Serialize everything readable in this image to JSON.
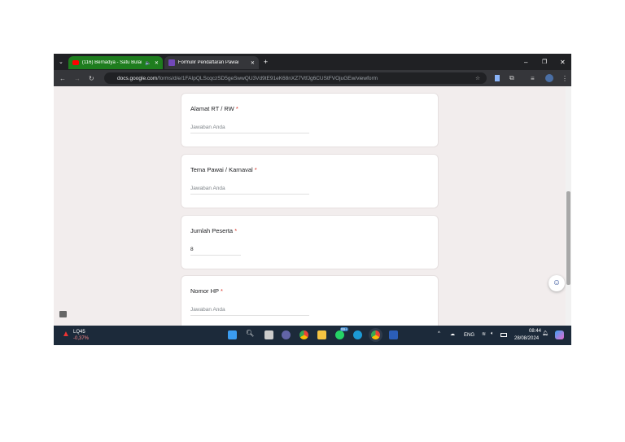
{
  "browser": {
    "tabs": [
      {
        "label": "(116) Bernadya - Satu Bulan",
        "active": false
      },
      {
        "label": "Formulir Pendaftaran Pawai",
        "active": true
      }
    ],
    "url_domain": "docs.google.com",
    "url_path": "/forms/d/e/1FAIpQLScqczSD5geSwwQU3Vd9tE91eK68nXZ7VtfJg6CUStFVOjuGEw/viewform"
  },
  "form": {
    "questions": [
      {
        "label": "Alamat RT / RW",
        "required": "*",
        "answer": "Jawaban Anda"
      },
      {
        "label": "Tema Pawai /  Karnaval",
        "required": "*",
        "answer": "Jawaban Anda"
      },
      {
        "label": "Jumlah Peserta",
        "required": "*",
        "answer": "8"
      },
      {
        "label": "Nomor HP",
        "required": "*",
        "answer": "Jawaban Anda"
      }
    ]
  },
  "taskbar": {
    "stock_name": "LQ45",
    "stock_change": "-0,37%",
    "lang": "ENG",
    "time": "08:44",
    "date": "28/08/2024",
    "whatsapp_badge": "99+"
  }
}
